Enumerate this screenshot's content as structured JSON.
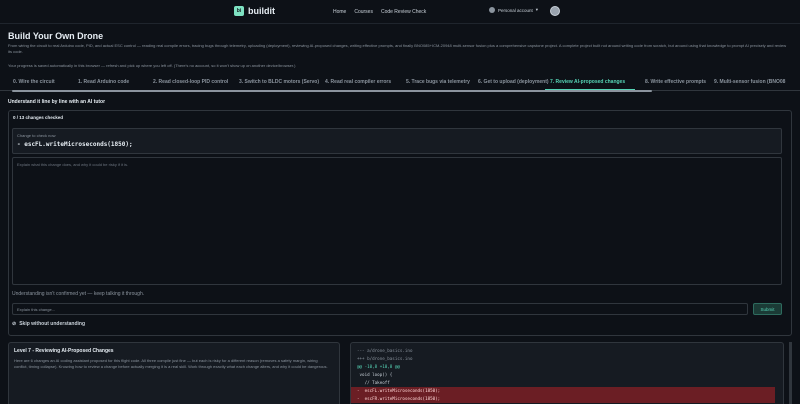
{
  "nav": {
    "logo_mark": "bi",
    "logo_text": "buildit",
    "links": [
      "Home",
      "Courses",
      "Code Review Check"
    ],
    "account_label": "Personal account",
    "account_caret": "▾"
  },
  "page": {
    "title": "Build Your Own Drone",
    "description": "From wiring the circuit to real Arduino code, PID, and actual ESC control — reading real compile errors, tracing bugs through telemetry, uploading (deployment), reviewing AI-proposed changes, writing effective prompts, and finally BNO085+ICM-20948 multi-sensor fusion plus a comprehensive capstone project. A complete project built not around writing code from scratch, but around using that knowledge to prompt AI precisely and review its code.",
    "progress_note": "Your progress is saved automatically in this browser — refresh and pick up where you left off. (There's no account, so it won't show up on another device/browser.)"
  },
  "tabs": [
    {
      "label": "0. Wire the circuit",
      "active": false
    },
    {
      "label": "1. Read Arduino code",
      "active": false
    },
    {
      "label": "2. Read closed-loop PID control",
      "active": false
    },
    {
      "label": "3. Switch to BLDC motors (Servo)",
      "active": false
    },
    {
      "label": "4. Read real compiler errors",
      "active": false
    },
    {
      "label": "5. Trace bugs via telemetry",
      "active": false
    },
    {
      "label": "6. Get to upload (deployment)",
      "active": false
    },
    {
      "label": "7. Review AI-proposed changes",
      "active": true
    },
    {
      "label": "8. Write effective prompts",
      "active": false
    },
    {
      "label": "9. Multi-sensor fusion (BNO08",
      "active": false
    }
  ],
  "tutor": {
    "heading": "Understand it line by line with an AI tutor",
    "checked": "0 / 13 changes checked",
    "change_label": "Change to check now",
    "change_code": "-  escFL.writeMicroseconds(1850);",
    "explain_placeholder": "Explain what this change does, and why it could be risky if it is.",
    "status": "Understanding isn't confirmed yet — keep talking it through.",
    "input_placeholder": "Explain this change...",
    "submit_label": "Submit",
    "skip_icon": "⊘",
    "skip_label": "Skip without understanding"
  },
  "level": {
    "title": "Level 7 - Reviewing AI-Proposed Changes",
    "description": "Here are 6 changes an AI coding assistant proposed for this flight code. All three compile just fine — but each is risky for a different reason (removes a safety margin, wiring conflict, timing collapse). Knowing how to review a change before actually merging it is a real skill. Work through exactly what each change alters, and why it could be dangerous."
  },
  "diff": {
    "lines": [
      {
        "text": "--- a/drone_basics.ino",
        "kind": "meta"
      },
      {
        "text": "+++ b/drone_basics.ino",
        "kind": "meta"
      },
      {
        "text": "@@ -10,8 +10,8 @@",
        "kind": "hunk"
      },
      {
        "text": " void loop() {",
        "kind": "context"
      },
      {
        "text": "   // Takeoff",
        "kind": "context"
      },
      {
        "text": "-  escFL.writeMicroseconds(1850);",
        "kind": "removed"
      },
      {
        "text": "-  escFR.writeMicroseconds(1850);",
        "kind": "removed"
      }
    ]
  },
  "colors": {
    "accent": "#56d4b6",
    "background": "#0d1117",
    "removed_bg": "#6b1e24"
  }
}
